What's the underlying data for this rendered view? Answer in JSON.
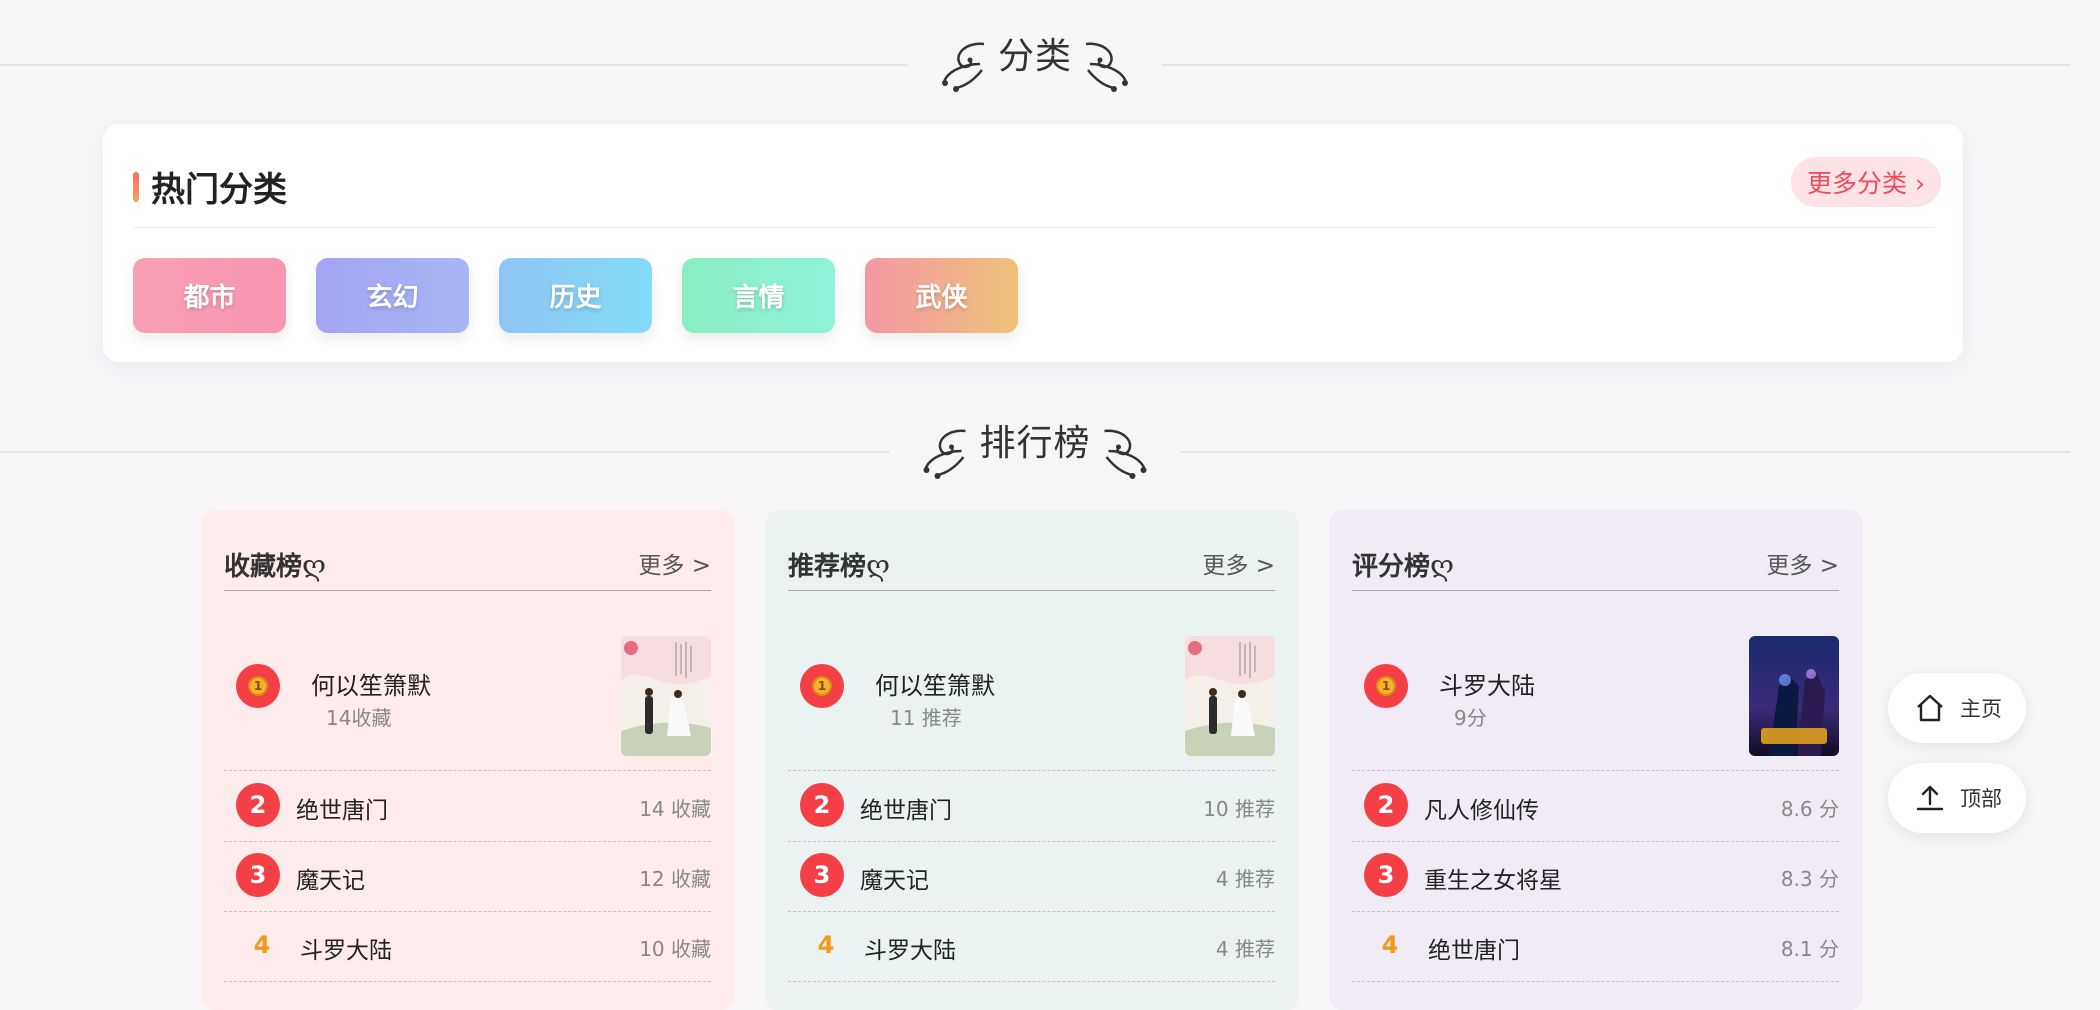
{
  "sections": {
    "category_heading": "分类",
    "ranking_heading": "排行榜"
  },
  "category_card": {
    "title": "热门分类",
    "more_label": "更多分类 ›",
    "tags": [
      {
        "label": "都市",
        "gradient": [
          "#f7a0b5",
          "#f996b1"
        ]
      },
      {
        "label": "玄幻",
        "gradient": [
          "#a3a3f2",
          "#a9b6f5"
        ]
      },
      {
        "label": "历史",
        "gradient": [
          "#8fc5f5",
          "#83dbf7"
        ]
      },
      {
        "label": "言情",
        "gradient": [
          "#8bedc2",
          "#8ff2d9"
        ]
      },
      {
        "label": "武侠",
        "gradient": [
          "#f597a4",
          "#eec27a"
        ]
      }
    ]
  },
  "rankings": [
    {
      "title": "收藏榜",
      "title_suffix": "ღ",
      "more_label": "更多 >",
      "bg": "#fdeceb",
      "top": {
        "name": "何以笙箫默",
        "meta": "14收藏",
        "cover": "wedding"
      },
      "rows": [
        {
          "rank": "2",
          "name": "绝世唐门",
          "value": "14 收藏"
        },
        {
          "rank": "3",
          "name": "魔天记",
          "value": "12 收藏"
        },
        {
          "rank": "4",
          "name": "斗罗大陆",
          "value": "10 收藏"
        }
      ]
    },
    {
      "title": "推荐榜",
      "title_suffix": "ღ",
      "more_label": "更多 >",
      "bg": "#eaf3f2",
      "top": {
        "name": "何以笙箫默",
        "meta": "11 推荐",
        "cover": "wedding"
      },
      "rows": [
        {
          "rank": "2",
          "name": "绝世唐门",
          "value": "10 推荐"
        },
        {
          "rank": "3",
          "name": "魔天记",
          "value": "4 推荐"
        },
        {
          "rank": "4",
          "name": "斗罗大陆",
          "value": "4 推荐"
        }
      ]
    },
    {
      "title": "评分榜",
      "title_suffix": "ღ",
      "more_label": "更多 >",
      "bg": "#f0ebf5",
      "top": {
        "name": "斗罗大陆",
        "meta": "9分",
        "cover": "fantasy"
      },
      "rows": [
        {
          "rank": "2",
          "name": "凡人修仙传",
          "value": "8.6 分"
        },
        {
          "rank": "3",
          "name": "重生之女将星",
          "value": "8.3 分"
        },
        {
          "rank": "4",
          "name": "绝世唐门",
          "value": "8.1 分"
        }
      ]
    }
  ],
  "medal_glyph": "1",
  "fab": {
    "home_label": "主页",
    "top_label": "顶部",
    "home_icon": "home-icon",
    "top_icon": "upload-icon"
  },
  "colors": {
    "accent_red": "#f43f46",
    "rank4_orange": "#f09a1a",
    "more_pink": "#ef4a5a"
  }
}
